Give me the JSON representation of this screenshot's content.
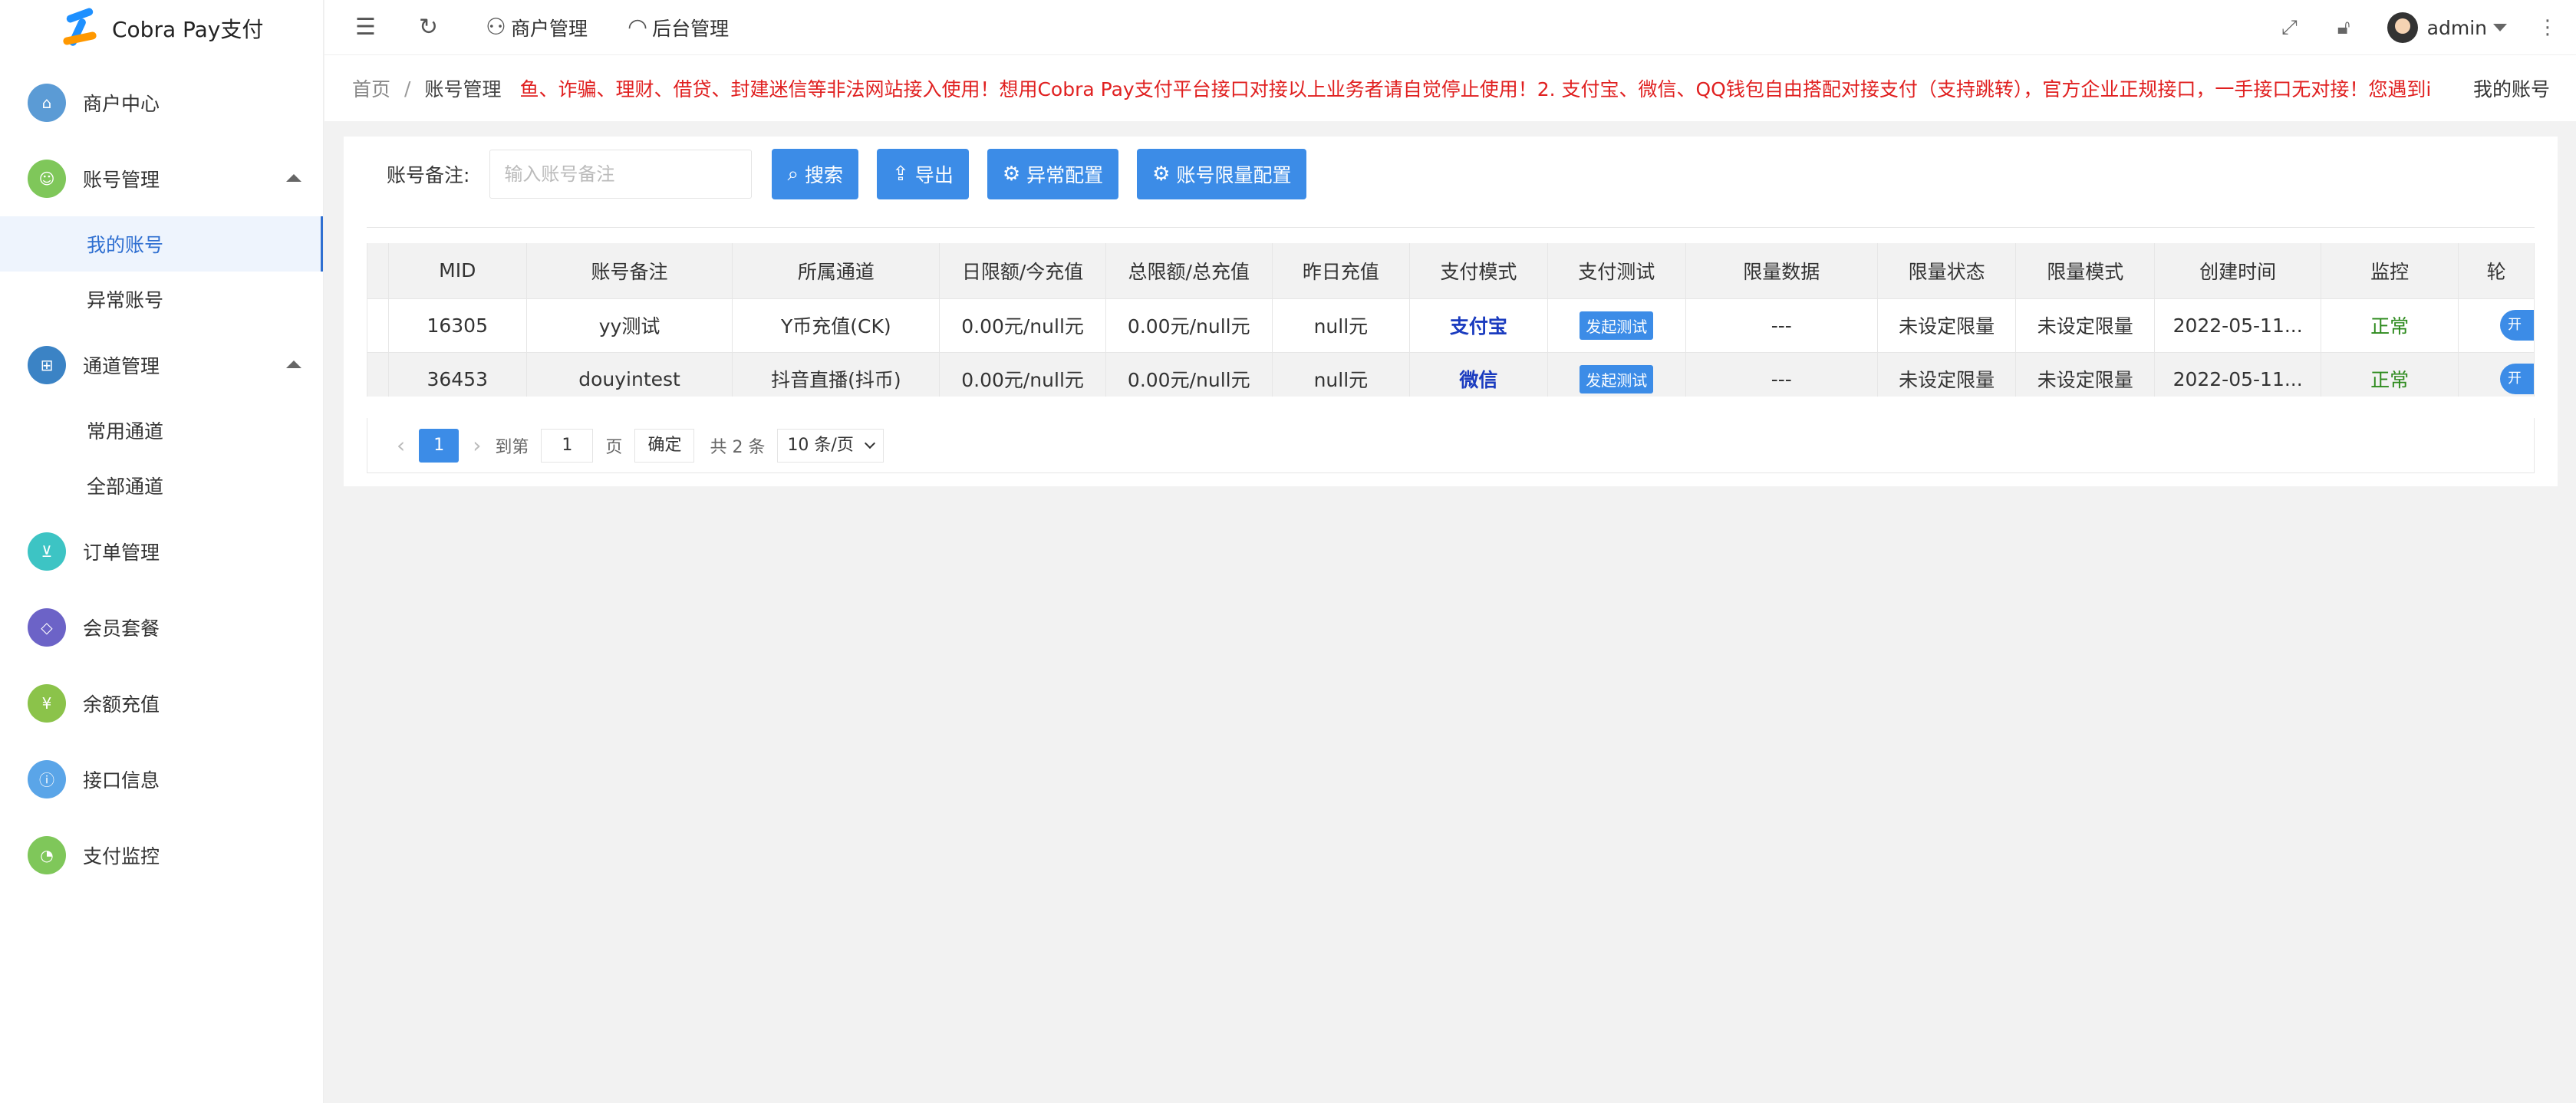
{
  "app": {
    "title": "Cobra Pay支付"
  },
  "sidebar": {
    "items": [
      {
        "label": "商户中心",
        "color": "#5b9bd5",
        "icon": "home-icon"
      },
      {
        "label": "账号管理",
        "color": "#7fc75a",
        "icon": "user-icon",
        "expanded": true,
        "children": [
          {
            "label": "我的账号",
            "active": true
          },
          {
            "label": "异常账号"
          }
        ]
      },
      {
        "label": "通道管理",
        "color": "#3b83c5",
        "icon": "channel-icon",
        "expanded": true,
        "children": [
          {
            "label": "常用通道"
          },
          {
            "label": "全部通道"
          }
        ]
      },
      {
        "label": "订单管理",
        "color": "#3dc4c4",
        "icon": "cart-icon"
      },
      {
        "label": "会员套餐",
        "color": "#6c63c7",
        "icon": "diamond-icon"
      },
      {
        "label": "余额充值",
        "color": "#8bc34a",
        "icon": "yen-icon"
      },
      {
        "label": "接口信息",
        "color": "#5aa5e8",
        "icon": "info-icon"
      },
      {
        "label": "支付监控",
        "color": "#7fc75a",
        "icon": "monitor-icon"
      }
    ]
  },
  "topbar": {
    "merchant_label": "商户管理",
    "backend_label": "后台管理",
    "user": "admin"
  },
  "breadcrumb": {
    "home": "首页",
    "current": "账号管理",
    "notice": "鱼、诈骗、理财、借贷、封建迷信等非法网站接入使用！想用Cobra Pay支付平台接口对接以上业务者请自觉停止使用！2. 支付宝、微信、QQ钱包自由搭配对接支付（支持跳转），官方企业正规接口，一手接口无对接！您遇到i",
    "right_label": "我的账号"
  },
  "search": {
    "label": "账号备注:",
    "placeholder": "输入账号备注",
    "search_btn": "搜索",
    "export_btn": "导出",
    "abnormal_btn": "异常配置",
    "limit_btn": "账号限量配置"
  },
  "table": {
    "columns": [
      "MID",
      "账号备注",
      "所属通道",
      "日限额/今充值",
      "总限额/总充值",
      "昨日充值",
      "支付模式",
      "支付测试",
      "限量数据",
      "限量状态",
      "限量模式",
      "创建时间",
      "监控",
      "轮"
    ],
    "rows": [
      {
        "mid": "16305",
        "remark": "yy测试",
        "channel": "Y币充值(CK)",
        "daily": "0.00元/null元",
        "total": "0.00元/null元",
        "yesterday": "null元",
        "mode": "支付宝",
        "test": "发起测试",
        "limit_data": "---",
        "limit_status": "未设定限量",
        "limit_mode": "未设定限量",
        "created": "2022-05-11...",
        "monitor": "正常",
        "toggle": "开"
      },
      {
        "mid": "36453",
        "remark": "douyintest",
        "channel": "抖音直播(抖币)",
        "daily": "0.00元/null元",
        "total": "0.00元/null元",
        "yesterday": "null元",
        "mode": "微信",
        "test": "发起测试",
        "limit_data": "---",
        "limit_status": "未设定限量",
        "limit_mode": "未设定限量",
        "created": "2022-05-11...",
        "monitor": "正常",
        "toggle": "开"
      }
    ]
  },
  "pager": {
    "current": "1",
    "goto_label": "到第",
    "goto_value": "1",
    "page_label": "页",
    "ok": "确定",
    "total": "共 2 条",
    "size": "10 条/页"
  }
}
